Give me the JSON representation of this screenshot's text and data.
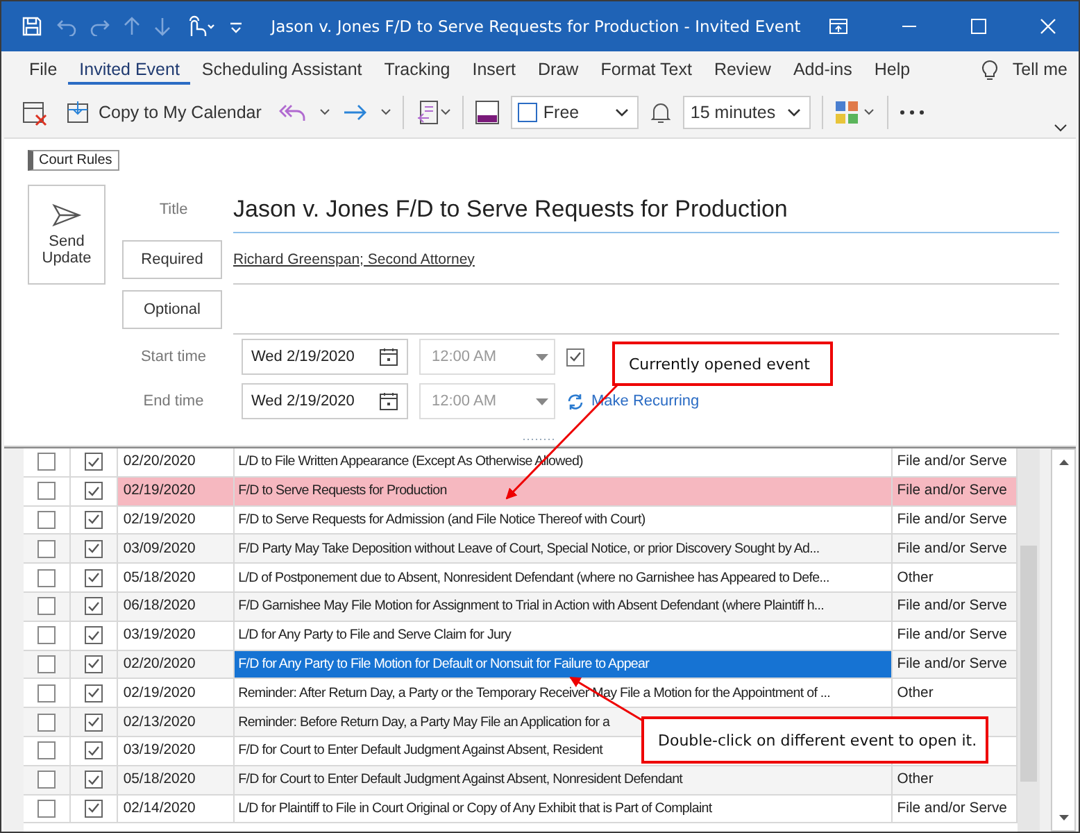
{
  "window": {
    "title": "Jason v. Jones F/D to Serve Requests for Production  -  Invited Event"
  },
  "menu_tabs": [
    {
      "label": "File",
      "selected": false
    },
    {
      "label": "Invited Event",
      "selected": true
    },
    {
      "label": "Scheduling Assistant",
      "selected": false
    },
    {
      "label": "Tracking",
      "selected": false
    },
    {
      "label": "Insert",
      "selected": false
    },
    {
      "label": "Draw",
      "selected": false
    },
    {
      "label": "Format Text",
      "selected": false
    },
    {
      "label": "Review",
      "selected": false
    },
    {
      "label": "Add-ins",
      "selected": false
    },
    {
      "label": "Help",
      "selected": false
    }
  ],
  "tell_me": "Tell me",
  "toolbar": {
    "copy_button": "Copy to My Calendar",
    "show_as": "Free",
    "reminder": "15 minutes"
  },
  "category": "Court Rules",
  "send_button": "Send Update",
  "form": {
    "title_label": "Title",
    "title": "Jason v. Jones F/D to Serve Requests for Production",
    "required_button": "Required",
    "attendees": "Richard Greenspan; Second Attorney",
    "optional_button": "Optional",
    "all_day_checked": true,
    "start_label": "Start time",
    "start_date": "Wed 2/19/2020",
    "start_time": "12:00 AM",
    "end_label": "End time",
    "end_date": "Wed 2/19/2020",
    "end_time": "12:00 AM",
    "recurring_link": "Make Recurring"
  },
  "table": {
    "rows": [
      {
        "include": false,
        "active": true,
        "date": "02/20/2020",
        "description": "L/D to File Written Appearance (Except As Otherwise Allowed)",
        "type": "File and/or Serve",
        "current": false,
        "selected": false
      },
      {
        "include": false,
        "active": true,
        "date": "02/19/2020",
        "description": "F/D to Serve Requests for Production",
        "type": "File and/or Serve",
        "current": true,
        "selected": false
      },
      {
        "include": false,
        "active": true,
        "date": "02/19/2020",
        "description": "F/D to Serve Requests for Admission (and File Notice Thereof with Court)",
        "type": "File and/or Serve",
        "current": false,
        "selected": false
      },
      {
        "include": false,
        "active": true,
        "date": "03/09/2020",
        "description": "F/D Party May Take Deposition without Leave of Court, Special Notice, or prior Discovery Sought by Ad...",
        "type": "File and/or Serve",
        "current": false,
        "selected": false
      },
      {
        "include": false,
        "active": true,
        "date": "05/18/2020",
        "description": "L/D of Postponement due to Absent, Nonresident Defendant (where no Garnishee has Appeared to Defe...",
        "type": "Other",
        "current": false,
        "selected": false
      },
      {
        "include": false,
        "active": true,
        "date": "06/18/2020",
        "description": "F/D Garnishee May File Motion for Assignment to Trial in Action with Absent Defendant (where Plaintiff h...",
        "type": "File and/or Serve",
        "current": false,
        "selected": false
      },
      {
        "include": false,
        "active": true,
        "date": "03/19/2020",
        "description": "L/D for Any Party to File and Serve Claim for Jury",
        "type": "File and/or Serve",
        "current": false,
        "selected": false
      },
      {
        "include": false,
        "active": true,
        "date": "02/20/2020",
        "description": "F/D for Any Party to File Motion for Default or Nonsuit for Failure to Appear",
        "type": "File and/or Serve",
        "current": false,
        "selected": true
      },
      {
        "include": false,
        "active": true,
        "date": "02/19/2020",
        "description": "Reminder: After Return Day, a Party or the Temporary Receiver May File a Motion for the Appointment of ...",
        "type": "Other",
        "current": false,
        "selected": false
      },
      {
        "include": false,
        "active": true,
        "date": "02/13/2020",
        "description": "Reminder: Before Return Day, a Party May File an Application for a",
        "current": false,
        "selected": false
      },
      {
        "include": false,
        "active": true,
        "date": "03/19/2020",
        "description": "F/D for Court to Enter Default Judgment Against Absent, Resident",
        "current": false,
        "selected": false
      },
      {
        "include": false,
        "active": true,
        "date": "05/18/2020",
        "description": "F/D for Court to Enter Default Judgment Against Absent, Nonresident Defendant",
        "type": "Other",
        "current": false,
        "selected": false
      },
      {
        "include": false,
        "active": true,
        "date": "02/14/2020",
        "description": "L/D for Plaintiff to File in Court Original or Copy of Any Exhibit that is Part of Complaint",
        "type": "File and/or Serve",
        "current": false,
        "selected": false
      }
    ]
  },
  "callouts": [
    {
      "text": "Currently opened event"
    },
    {
      "text": "Double-click on different event to open it."
    }
  ]
}
